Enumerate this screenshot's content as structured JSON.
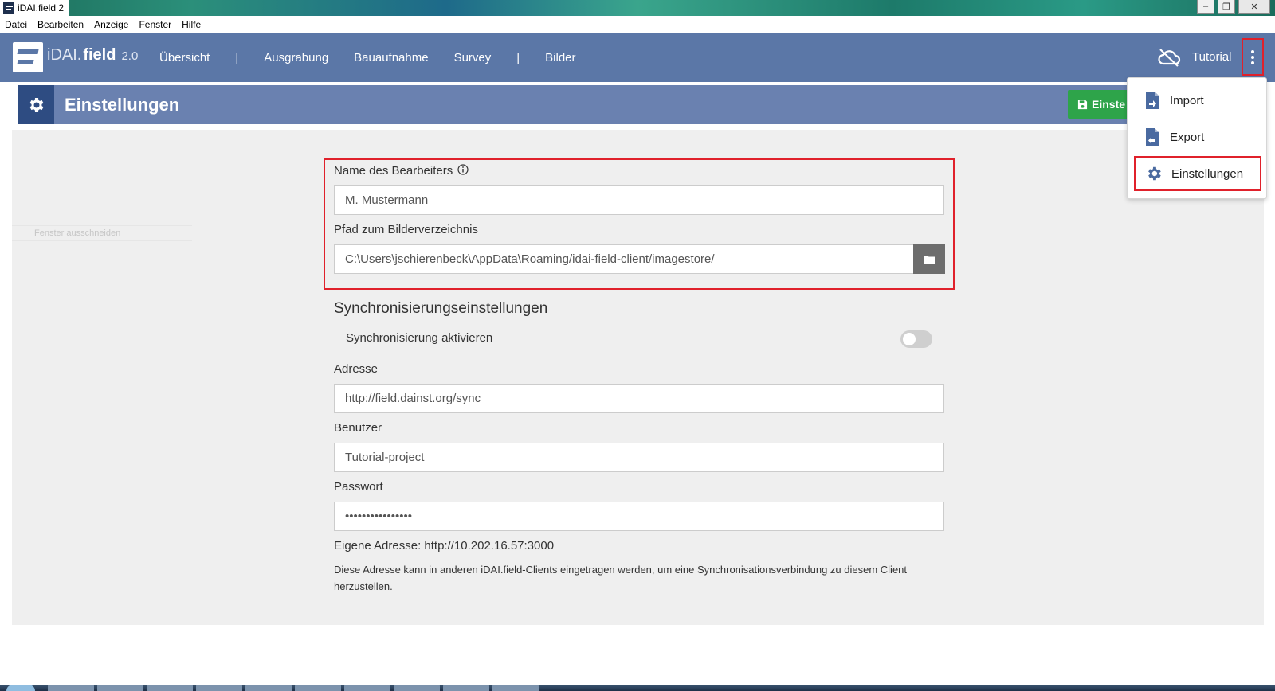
{
  "window": {
    "title": "iDAI.field 2",
    "controls": {
      "minimize": "–",
      "restore": "❐",
      "close": "✕"
    }
  },
  "menubar": {
    "items": [
      "Datei",
      "Bearbeiten",
      "Anzeige",
      "Fenster",
      "Hilfe"
    ]
  },
  "navbar": {
    "brand_prefix": "iDAI.",
    "brand_name": "field",
    "brand_version": "2.0",
    "links": [
      "Übersicht",
      "|",
      "Ausgrabung",
      "Bauaufnahme",
      "Survey",
      "|",
      "Bilder"
    ],
    "project_name": "Tutorial",
    "icons": {
      "sync_status": "cloud-off-icon",
      "menu": "more-vertical-icon"
    }
  },
  "page_header": {
    "title": "Einstellungen",
    "icon": "gear-icon",
    "save_button_label": "Einste",
    "save_button_icon": "floppy-disk-icon"
  },
  "sidebar": {
    "ghost_label": "Fenster ausschneiden"
  },
  "settings": {
    "username_label": "Name des Bearbeiters",
    "username_value": "M. Mustermann",
    "imagestore_label": "Pfad zum Bilderverzeichnis",
    "imagestore_value": "C:\\Users\\jschierenbeck\\AppData\\Roaming/idai-field-client/imagestore/",
    "sync_section_title": "Synchronisierungseinstellungen",
    "sync_toggle_label": "Synchronisierung aktivieren",
    "sync_enabled": false,
    "address_label": "Adresse",
    "address_value": "http://field.dainst.org/sync",
    "user_label": "Benutzer",
    "user_value": "Tutorial-project",
    "password_label": "Passwort",
    "password_value": "••••••••••••••••",
    "own_address": "Eigene Adresse: http://10.202.16.57:3000",
    "own_address_help": "Diese Adresse kann in anderen iDAI.field-Clients eingetragen werden, um eine Synchronisationsverbindung zu diesem Client herzustellen."
  },
  "dropdown": {
    "items": [
      {
        "label": "Import",
        "icon": "file-import-icon"
      },
      {
        "label": "Export",
        "icon": "file-export-icon"
      },
      {
        "label": "Einstellungen",
        "icon": "gear-icon"
      }
    ]
  },
  "colors": {
    "navbar_bg": "#5b77a7",
    "page_header_bg": "#6a81b0",
    "header_icon_bg": "#2e4c82",
    "save_button": "#2ea44a",
    "highlight_annotation": "#e0212b",
    "content_bg": "#efefef"
  }
}
